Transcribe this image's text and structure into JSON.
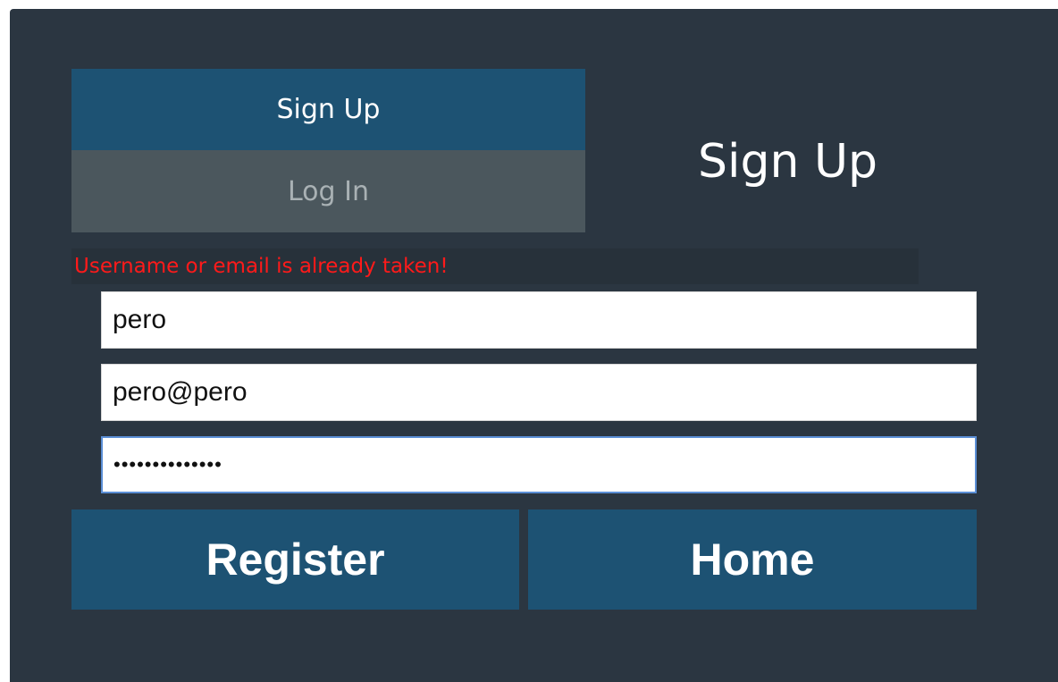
{
  "tabs": {
    "signup_label": "Sign Up",
    "login_label": "Log In"
  },
  "heading": "Sign Up",
  "error_message": "Username or email is already taken!",
  "form": {
    "username_value": "pero",
    "email_value": "pero@pero",
    "password_value": "••••••••••••••"
  },
  "buttons": {
    "register_label": "Register",
    "home_label": "Home"
  },
  "colors": {
    "panel_background": "#2b3641",
    "accent": "#1d5273",
    "inactive_tab": "#4b575d",
    "error_text": "#ff1a1a"
  }
}
